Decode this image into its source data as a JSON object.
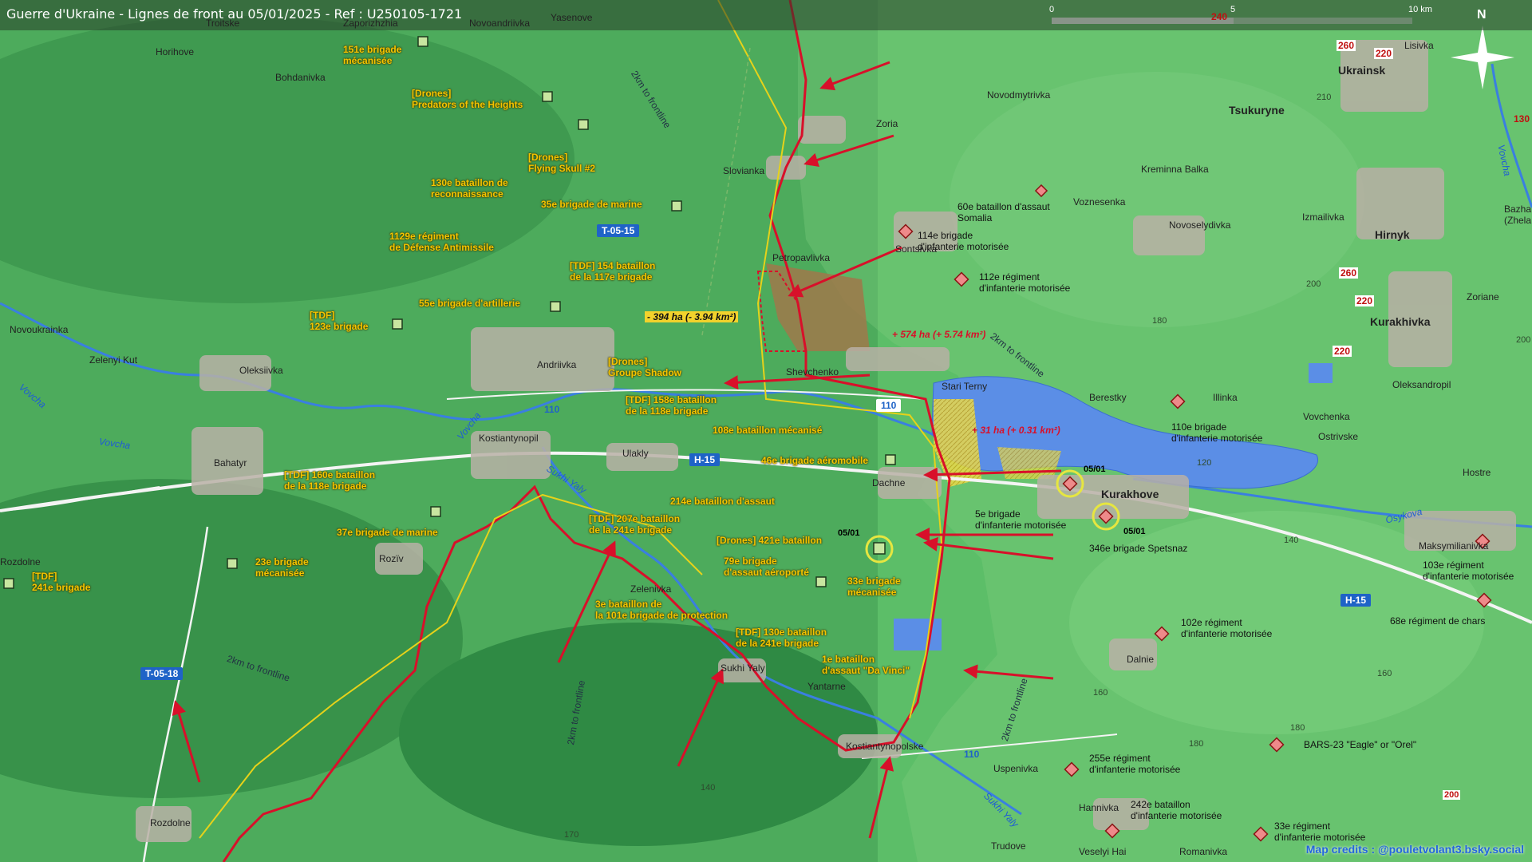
{
  "header": {
    "title": "Guerre d'Ukraine - Lignes de front au 05/01/2025 - Ref : U250105-1721"
  },
  "scale": {
    "labels": [
      "0",
      "5",
      "10 km"
    ]
  },
  "compass": {
    "north": "N"
  },
  "credits": "Map credits : @pouletvolant3.bsky.social",
  "towns": [
    {
      "id": "horihove",
      "name": "Horihove"
    },
    {
      "id": "bohdanivka",
      "name": "Bohdanivka"
    },
    {
      "id": "novoukrainka",
      "name": "Novoukrainka"
    },
    {
      "id": "zelenyi-kut",
      "name": "Zelenyi Kut"
    },
    {
      "id": "oleksiivka",
      "name": "Oleksiivka"
    },
    {
      "id": "andriivka",
      "name": "Andriivka"
    },
    {
      "id": "kostiantynopil",
      "name": "Kostiantynopil"
    },
    {
      "id": "bahatyr",
      "name": "Bahatyr"
    },
    {
      "id": "ulakly",
      "name": "Ulakly"
    },
    {
      "id": "rozdolne",
      "name": "Rozdolne"
    },
    {
      "id": "rozdolne2",
      "name": "Rozdolne"
    },
    {
      "id": "roziv",
      "name": "Rozïv"
    },
    {
      "id": "zelenivka",
      "name": "Zelenivka"
    },
    {
      "id": "sukhi-yaly",
      "name": "Sukhi Yaly"
    },
    {
      "id": "yantarne",
      "name": "Yantarne"
    },
    {
      "id": "kostiantynopolske",
      "name": "Kostiantynopolske"
    },
    {
      "id": "slovianka",
      "name": "Slovianka"
    },
    {
      "id": "zoria",
      "name": "Zoria"
    },
    {
      "id": "petropavlivka",
      "name": "Petropavlivka"
    },
    {
      "id": "shevchenko",
      "name": "Shevchenko"
    },
    {
      "id": "stari-terny",
      "name": "Stari Terny"
    },
    {
      "id": "sontsivka",
      "name": "Sontsivka"
    },
    {
      "id": "dachne",
      "name": "Dachne"
    },
    {
      "id": "kurakhove",
      "name": "Kurakhove"
    },
    {
      "id": "novodmytrivka",
      "name": "Novodmytrivka"
    },
    {
      "id": "voznesenka",
      "name": "Voznesenka"
    },
    {
      "id": "kreminna-balka",
      "name": "Kreminna Balka"
    },
    {
      "id": "tsukuryne",
      "name": "Tsukuryne"
    },
    {
      "id": "ukrainsk",
      "name": "Ukrainsk"
    },
    {
      "id": "lisivka",
      "name": "Lisivka"
    },
    {
      "id": "novoselydivka",
      "name": "Novoselydivka"
    },
    {
      "id": "izmailivka",
      "name": "Izmailivka"
    },
    {
      "id": "hirnyk",
      "name": "Hirnyk"
    },
    {
      "id": "kurakhivka",
      "name": "Kurakhivka"
    },
    {
      "id": "zoriane",
      "name": "Zoriane"
    },
    {
      "id": "oleksandropil",
      "name": "Oleksandropil"
    },
    {
      "id": "berestky",
      "name": "Berestky"
    },
    {
      "id": "illinka",
      "name": "Illinka"
    },
    {
      "id": "ostrivske",
      "name": "Ostrivske"
    },
    {
      "id": "vovchenka",
      "name": "Vovchenka"
    },
    {
      "id": "hostre",
      "name": "Hostre"
    },
    {
      "id": "maksymilianivka",
      "name": "Maksymilianivka"
    },
    {
      "id": "dalnie",
      "name": "Dalnie"
    },
    {
      "id": "uspenivka",
      "name": "Uspenivka"
    },
    {
      "id": "hannivka",
      "name": "Hannivka"
    },
    {
      "id": "trudove",
      "name": "Trudove"
    },
    {
      "id": "veselyi-hai",
      "name": "Veselyi Hai"
    },
    {
      "id": "romanivka",
      "name": "Romanivka"
    },
    {
      "id": "yasenove",
      "name": "Yasenove"
    },
    {
      "id": "zaporizhzhia",
      "name": "Zaporizhzhia"
    },
    {
      "id": "troitske",
      "name": "Troitske"
    },
    {
      "id": "novoandriivka",
      "name": "Novoandriivka"
    },
    {
      "id": "bazha",
      "name": "Bazha\n(Zhela"
    }
  ],
  "units_ua": [
    {
      "id": "u151",
      "text": "151e brigade\nmécanisée"
    },
    {
      "id": "predators",
      "text": "[Drones]\nPredators of the Heights"
    },
    {
      "id": "flyingskull",
      "text": "[Drones]\nFlying Skull #2"
    },
    {
      "id": "u130r",
      "text": "130e bataillon de\nreconnaissance"
    },
    {
      "id": "u35m",
      "text": "35e brigade de marine"
    },
    {
      "id": "u1129",
      "text": "1129e régiment\nde Défense Antimissile"
    },
    {
      "id": "tdf154",
      "text": "[TDF] 154 bataillon\nde la 117e brigade"
    },
    {
      "id": "u55a",
      "text": "55e brigade d'artillerie"
    },
    {
      "id": "tdf123",
      "text": "[TDF]\n123e brigade"
    },
    {
      "id": "shadow",
      "text": "[Drones]\nGroupe Shadow"
    },
    {
      "id": "tdf158",
      "text": "[TDF] 158e bataillon\nde la 118e brigade"
    },
    {
      "id": "u108",
      "text": "108e bataillon mécanisé"
    },
    {
      "id": "u46",
      "text": "46e brigade aéromobile"
    },
    {
      "id": "tdf160",
      "text": "[TDF] 160e bataillon\nde la 118e brigade"
    },
    {
      "id": "u214",
      "text": "214e bataillon d'assaut"
    },
    {
      "id": "tdf207",
      "text": "[TDF] 207e bataillon\nde la 241e brigade"
    },
    {
      "id": "u421",
      "text": "[Drones] 421e bataillon"
    },
    {
      "id": "u37m",
      "text": "37e brigade de marine"
    },
    {
      "id": "u79",
      "text": "79e brigade\nd'assaut aéroporté"
    },
    {
      "id": "u33",
      "text": "33e brigade\nmécanisée"
    },
    {
      "id": "u23",
      "text": "23e brigade\nmécanisée"
    },
    {
      "id": "tdf241",
      "text": "[TDF]\n241e brigade"
    },
    {
      "id": "u3b101",
      "text": "3e bataillon de\nla 101e brigade de protection"
    },
    {
      "id": "tdf130",
      "text": "[TDF] 130e bataillon\nde la 241e brigade"
    },
    {
      "id": "u1davinci",
      "text": "1e bataillon\nd'assaut \"Da Vinci\""
    }
  ],
  "units_ru": [
    {
      "id": "r60",
      "text": "60e bataillon d'assaut\nSomalia"
    },
    {
      "id": "r114",
      "text": "114e brigade\nd'infanterie motorisée"
    },
    {
      "id": "r112",
      "text": "112e régiment\nd'infanterie motorisée"
    },
    {
      "id": "r110",
      "text": "110e brigade\nd'infanterie motorisée"
    },
    {
      "id": "r5",
      "text": "5e brigade\nd'infanterie motorisée"
    },
    {
      "id": "r346",
      "text": "346e brigade Spetsnaz"
    },
    {
      "id": "r103",
      "text": "103e régiment\nd'infanterie motorisée"
    },
    {
      "id": "r68",
      "text": "68e régiment de chars"
    },
    {
      "id": "r102",
      "text": "102e régiment\nd'infanterie motorisée"
    },
    {
      "id": "rbars",
      "text": "BARS-23 \"Eagle\" or \"Orel\""
    },
    {
      "id": "r255",
      "text": "255e régiment\nd'infanterie motorisée"
    },
    {
      "id": "r242",
      "text": "242e bataillon\nd'infanterie motorisée"
    },
    {
      "id": "r33",
      "text": "33e régiment\nd'infanterie motorisée"
    }
  ],
  "area_changes": [
    {
      "id": "loss",
      "text": "- 394 ha (- 3.94 km²)"
    },
    {
      "id": "gain1",
      "text": "+ 574 ha (+ 5.74 km²)"
    },
    {
      "id": "gain2",
      "text": "+ 31 ha (+ 0.31 km²)"
    }
  ],
  "dates": [
    "05/01",
    "05/01",
    "05/01"
  ],
  "roads": [
    "T-05-15",
    "110",
    "110",
    "H-15",
    "T-05-18",
    "H-15",
    "110"
  ],
  "road_numbers": [
    "260",
    "220",
    "260",
    "220",
    "220",
    "240",
    "130"
  ],
  "elevations": [
    "210",
    "200",
    "180",
    "120",
    "140",
    "160",
    "170",
    "180",
    "180",
    "160",
    "140",
    "200",
    "200"
  ],
  "frontline_labels": [
    "2km to frontline",
    "2km to frontline",
    "2km to frontline",
    "2km to frontline",
    "2km to frontline"
  ],
  "rivers": [
    "Vovcha",
    "Vovcha",
    "Vovcha",
    "Sukhi Yaly",
    "Sukhi Yaly",
    "Osykova",
    "Vovcha"
  ],
  "colors": {
    "ua_unit_text": "#f5c400",
    "front_line": "#d8102a",
    "water": "#5b8ee6",
    "road_badge": "#1f63c7"
  }
}
